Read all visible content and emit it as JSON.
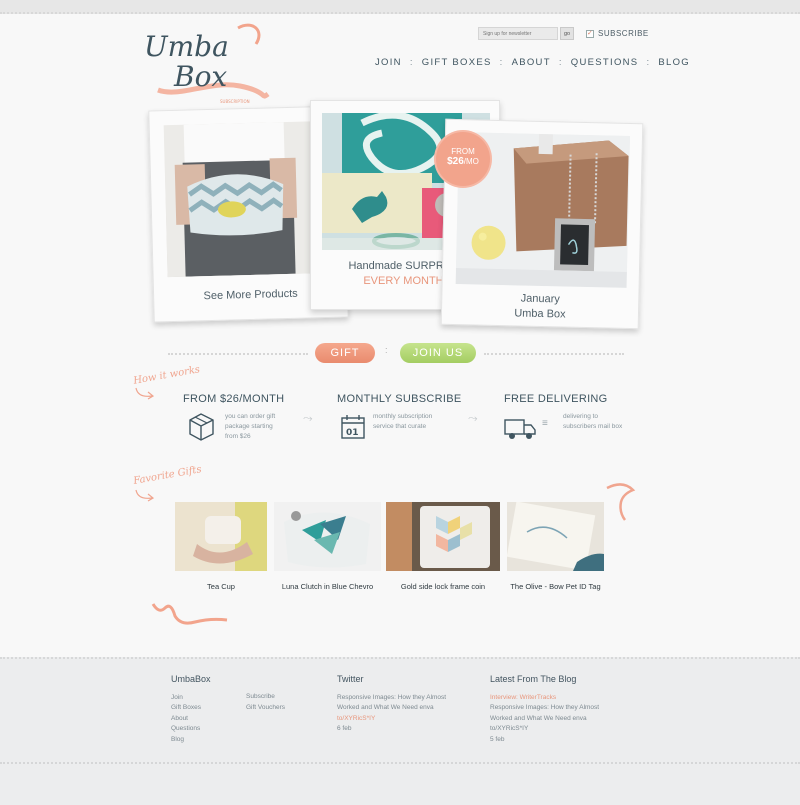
{
  "logo": {
    "line1": "Umba",
    "line2": "Box",
    "tagline": "SUBSCRIPTION"
  },
  "newsletter": {
    "placeholder": "Sign up for newsletter",
    "go_label": "go",
    "subscribe_label": "SUBSCRIBE",
    "subscribe_checked": true
  },
  "nav": {
    "items": [
      "JOIN",
      "GIFT BOXES",
      "ABOUT",
      "QUESTIONS",
      "BLOG"
    ],
    "separator": ":"
  },
  "hero": {
    "card1": {
      "caption": "See More Products"
    },
    "card2": {
      "caption_line1": "Handmade SURPRISE",
      "caption_line2": "EVERY MONTH!"
    },
    "card3": {
      "caption_line1": "January",
      "caption_line2": "Umba Box"
    },
    "badge": {
      "line1": "FROM",
      "price": "$26",
      "unit": "/MO"
    }
  },
  "cta": {
    "gift": "GIFT",
    "join": "JOIN US",
    "divider": ":"
  },
  "how_it_works": {
    "heading": "How it works",
    "steps": [
      {
        "title": "FROM $26/MONTH",
        "desc": "you can order gift package starting from $26",
        "icon": "box-icon"
      },
      {
        "title": "MONTHLY SUBSCRIBE",
        "desc": "monthly subscription service that curate",
        "icon": "calendar-icon",
        "day": "01"
      },
      {
        "title": "FREE DELIVERING",
        "desc": "delivering to subscribers mail box",
        "icon": "truck-icon"
      }
    ]
  },
  "favorite_gifts": {
    "heading": "Favorite Gifts",
    "items": [
      {
        "label": "Tea Cup"
      },
      {
        "label": "Luna Clutch in Blue Chevro"
      },
      {
        "label": "Gold side lock frame coin"
      },
      {
        "label": "The Olive - Bow Pet ID Tag"
      }
    ]
  },
  "footer": {
    "umbabox": {
      "title": "UmbaBox",
      "links1": [
        "Join",
        "Gift Boxes",
        "About",
        "Questions",
        "Blog"
      ],
      "links2": [
        "Subscribe",
        "Gift Vouchers"
      ]
    },
    "twitter": {
      "title": "Twitter",
      "text": "Responsive Images: How they Almost Worked and What We Need enva",
      "link": "to/XYRicS*IY",
      "date": "6 feb"
    },
    "blog": {
      "title": "Latest From The Blog",
      "highlight": "Interview: WriterTracks",
      "text": "Responsive Images: How they Almost Worked and What We Need enva to/XYRicS*IY",
      "date": "5 feb"
    }
  },
  "colors": {
    "accent": "#e8967c",
    "green": "#a4cd62",
    "text": "#3f5560",
    "background": "#f8f8f8"
  }
}
